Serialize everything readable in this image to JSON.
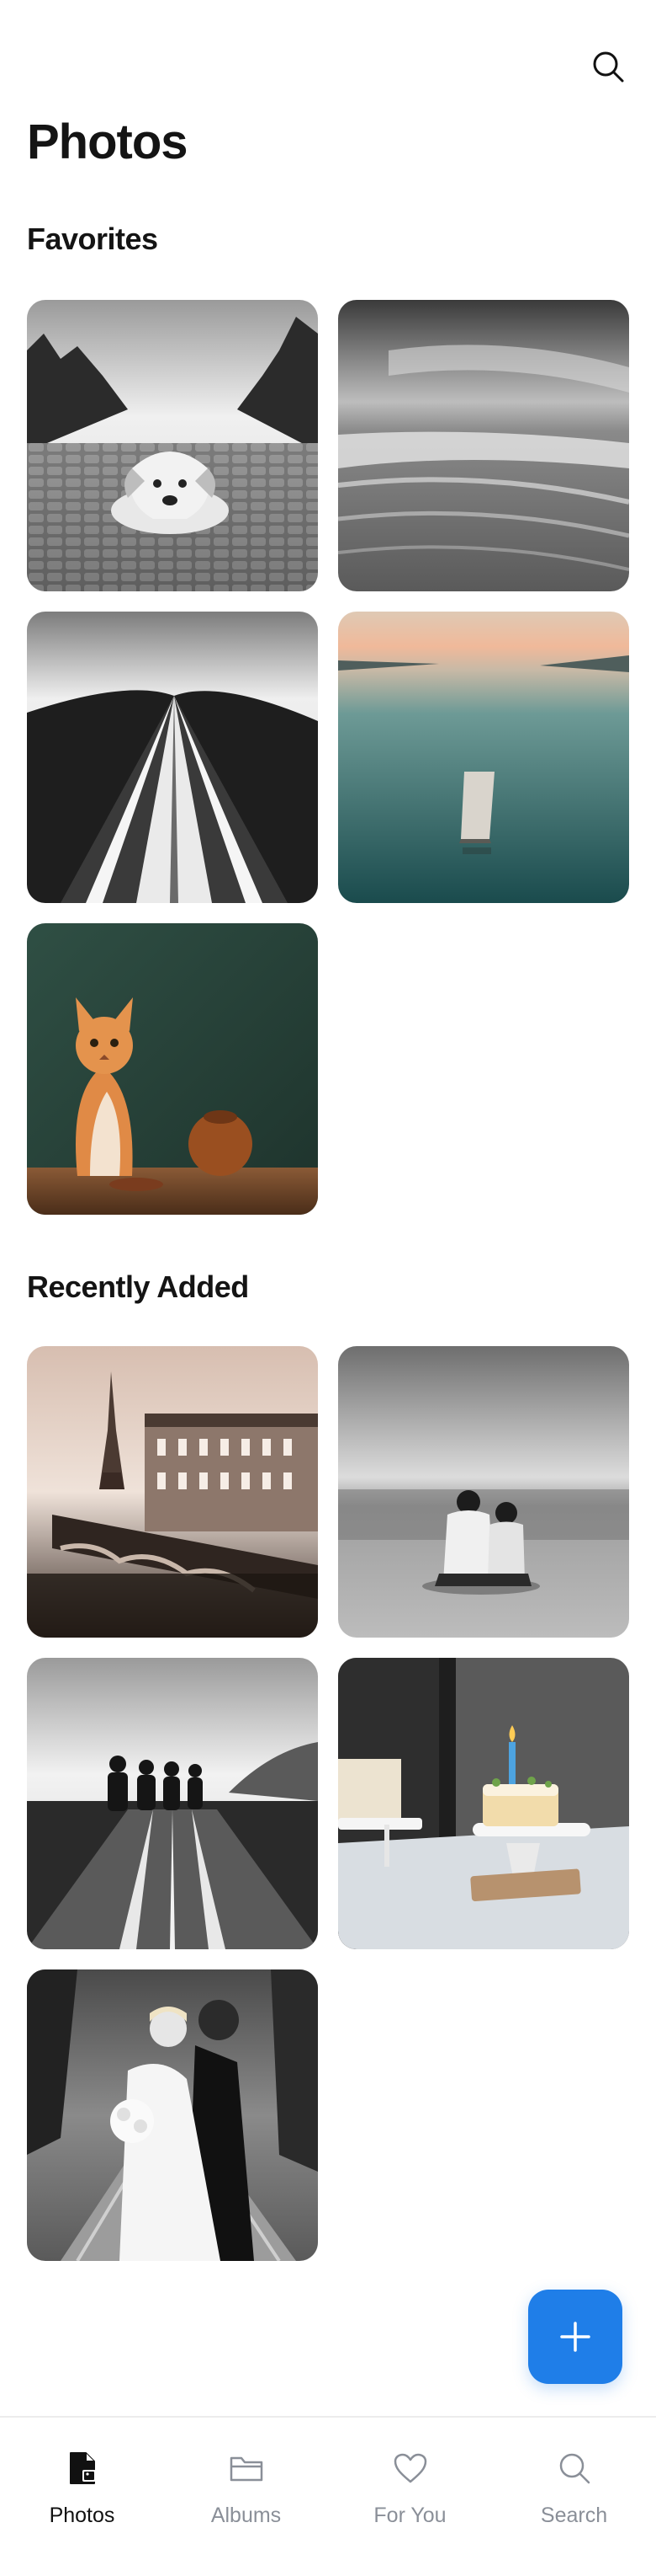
{
  "header": {
    "title": "Photos",
    "search_icon": "search-icon"
  },
  "sections": {
    "favorites": {
      "title": "Favorites",
      "photos": [
        {
          "subject": "dog lying on cobblestone road"
        },
        {
          "subject": "long exposure seascape"
        },
        {
          "subject": "curving road over hills"
        },
        {
          "subject": "wooden pier on calm lake at sunset"
        },
        {
          "subject": "orange cat on wooden table"
        }
      ]
    },
    "recent": {
      "title": "Recently Added",
      "photos": [
        {
          "subject": "Eiffel tower and Paris bridge"
        },
        {
          "subject": "couple sitting on beach"
        },
        {
          "subject": "three people walking on bridge"
        },
        {
          "subject": "birthday cake with candle"
        },
        {
          "subject": "wedding couple embracing"
        }
      ]
    }
  },
  "fab": {
    "icon": "plus-icon"
  },
  "nav": {
    "items": [
      {
        "label": "Photos",
        "icon": "photo-file-icon",
        "active": true
      },
      {
        "label": "Albums",
        "icon": "folder-icon",
        "active": false
      },
      {
        "label": "For You",
        "icon": "heart-icon",
        "active": false
      },
      {
        "label": "Search",
        "icon": "search-icon",
        "active": false
      }
    ]
  },
  "colors": {
    "accent": "#1f7ee8",
    "nav_active": "#111111",
    "nav_inactive": "#8a8f98"
  }
}
